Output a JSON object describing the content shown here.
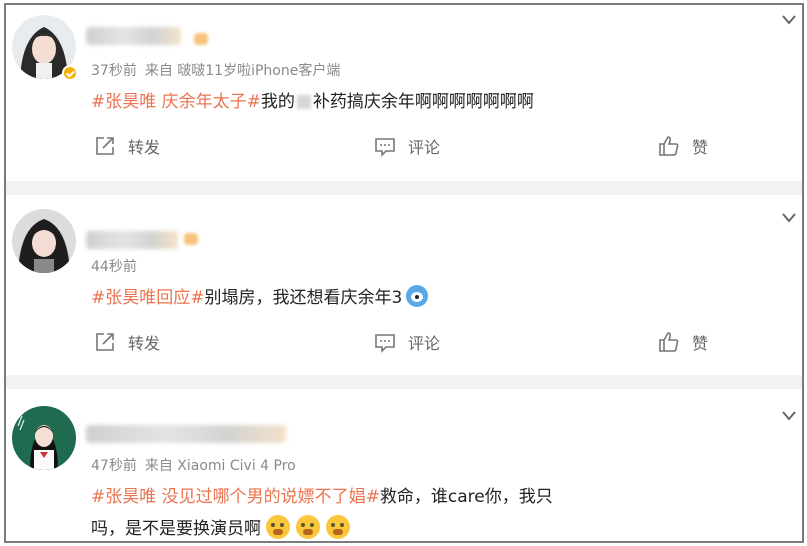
{
  "posts": [
    {
      "time": "37秒前",
      "source": "来自 啵啵11岁啦iPhone客户端",
      "tag": "#张昊唯 庆余年太子#",
      "text_before": "我的",
      "text_after": "补药搞庆余年啊啊啊啊啊啊啊",
      "text_line2": "",
      "verified": true,
      "actions": {
        "repost": "转发",
        "comment": "评论",
        "like": "赞"
      }
    },
    {
      "time": "44秒前",
      "source": "",
      "tag": "#张昊唯回应#",
      "text_before": "别塌房，我还想看庆余年3",
      "text_after": "",
      "text_line2": "",
      "verified": false,
      "actions": {
        "repost": "转发",
        "comment": "评论",
        "like": "赞"
      }
    },
    {
      "time": "47秒前",
      "source": "来自 Xiaomi Civi 4 Pro",
      "tag": "#张昊唯 没见过哪个男的说嫖不了娼#",
      "text_before": "救命，谁care你，我只",
      "text_after": "",
      "text_line2": "吗，是不是要换演员啊",
      "verified": false,
      "actions": {}
    }
  ],
  "icons": [
    "repost-icon",
    "comment-icon",
    "like-icon",
    "chevron-down-icon",
    "verified-badge-icon"
  ],
  "colors": {
    "tag": "#eb7350",
    "meta": "#8a8a8a",
    "separator": "#f2f2f2",
    "verified": "#f5b000"
  }
}
